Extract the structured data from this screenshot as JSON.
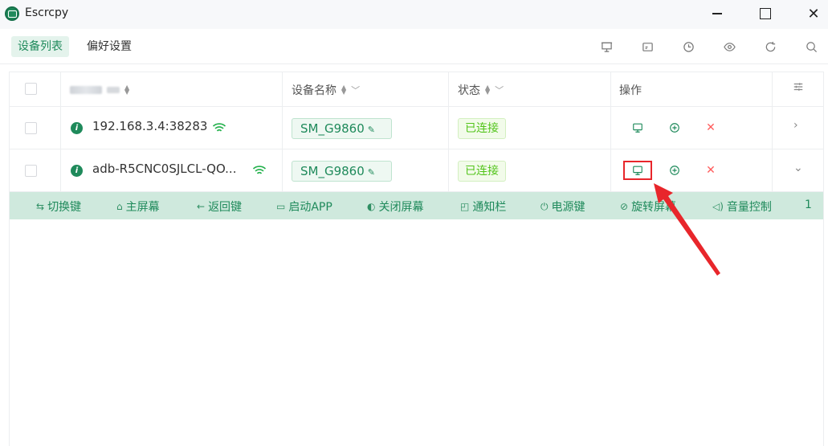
{
  "window": {
    "title": "Escrcpy",
    "close_glyph": "✕"
  },
  "tabs": [
    {
      "label": "设备列表",
      "active": true
    },
    {
      "label": "偏好设置",
      "active": false
    }
  ],
  "toolbar_icons": [
    "presentation-icon",
    "cast-icon",
    "history-icon",
    "eye-icon",
    "refresh-icon",
    "search-icon"
  ],
  "table": {
    "headers": {
      "name": "设备名称",
      "status": "状态",
      "actions": "操作"
    },
    "rows": [
      {
        "address": "192.168.3.4:38283",
        "device_name": "SM_G9860",
        "status": "已连接",
        "chevron": "›"
      },
      {
        "address": "adb-R5CNC0SJLCL-QO...",
        "device_name": "SM_G9860",
        "status": "已连接",
        "chevron": "⌄"
      }
    ]
  },
  "actionbar": [
    {
      "icon": "⇆",
      "label": "切换键"
    },
    {
      "icon": "⌂",
      "label": "主屏幕"
    },
    {
      "icon": "←",
      "label": "返回键"
    },
    {
      "icon": "▭",
      "label": "启动APP"
    },
    {
      "icon": "◐",
      "label": "关闭屏幕"
    },
    {
      "icon": "◰",
      "label": "通知栏"
    },
    {
      "icon": "⏻",
      "label": "电源键"
    },
    {
      "icon": "⊘",
      "label": "旋转屏幕"
    },
    {
      "icon": "◁)",
      "label": "音量控制"
    },
    {
      "icon": "",
      "label": "1"
    }
  ],
  "colors": {
    "accent": "#1f8a5b",
    "annotation": "#e8262b"
  }
}
